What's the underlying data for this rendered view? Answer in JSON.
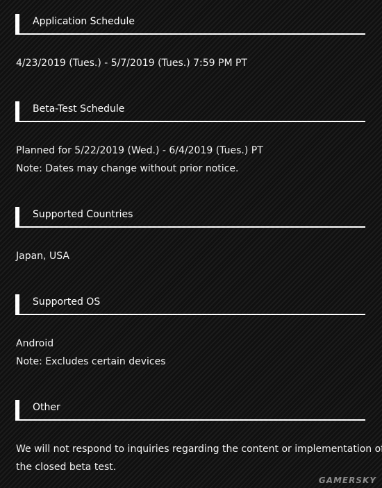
{
  "sections": [
    {
      "title": "Application Schedule",
      "lines": [
        "4/23/2019 (Tues.) - 5/7/2019 (Tues.) 7:59 PM PT"
      ]
    },
    {
      "title": "Beta-Test Schedule",
      "lines": [
        "Planned for 5/22/2019 (Wed.) - 6/4/2019 (Tues.) PT",
        "Note: Dates may change without prior notice."
      ]
    },
    {
      "title": "Supported Countries",
      "lines": [
        "Japan, USA"
      ]
    },
    {
      "title": "Supported OS",
      "lines": [
        "Android",
        "Note: Excludes certain devices"
      ]
    },
    {
      "title": "Other",
      "lines": [
        "We will not respond to inquiries regarding the content or implementation of",
        "the closed beta test."
      ]
    }
  ],
  "watermark": "GAMERSKY"
}
